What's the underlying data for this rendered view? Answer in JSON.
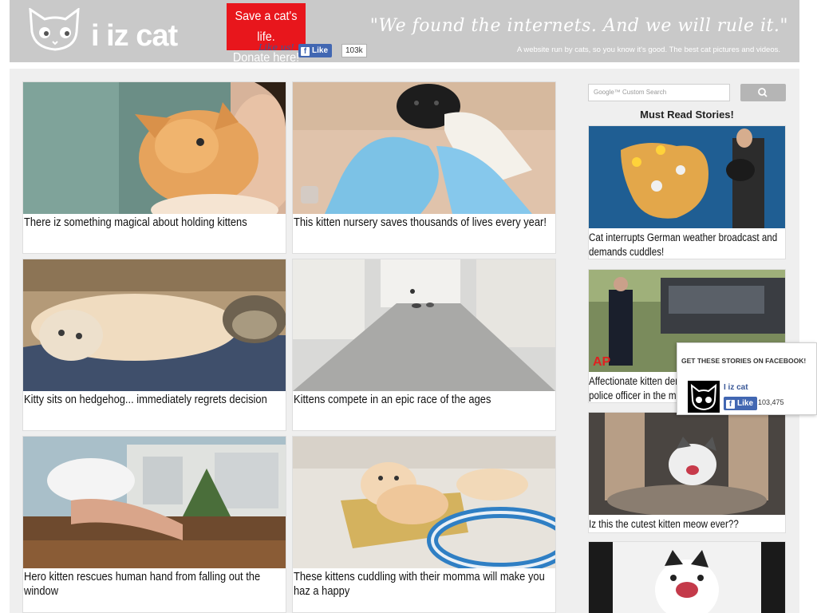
{
  "header": {
    "logo_text": "i iz cat",
    "donate_label": "Save a cat's life.\nDonate here!",
    "donate_line1": "Save a cat's life.",
    "donate_line2": "Donate here!",
    "like_us": "Like us!",
    "fb_like_label": "Like",
    "fb_like_count": "103k",
    "tagline": "\"We found the internets. And we will rule it.\"",
    "subtagline": "A website run by cats, so you know it's good. The best cat pictures and videos."
  },
  "articles": [
    {
      "caption": "There iz something magical about holding kittens"
    },
    {
      "caption": "This kitten nursery saves thousands of lives every year!"
    },
    {
      "caption": "Kitty sits on hedgehog... immediately regrets decision"
    },
    {
      "caption": "Kittens compete in an epic race of the ages"
    },
    {
      "caption": "Hero kitten rescues human hand from falling out the window"
    },
    {
      "caption": "These kittens cuddling with their momma will make you haz a happy"
    }
  ],
  "sidebar": {
    "search_placeholder": "Google™ Custom Search",
    "heading": "Must Read Stories!",
    "stories": [
      {
        "caption": "Cat interrupts German weather broadcast and demands cuddles!"
      },
      {
        "caption": "Affectionate kitten demands cuddles from police officer in the middle of an arrest"
      },
      {
        "caption": "Iz this the cutest kitten meow ever??"
      },
      {
        "caption": ""
      }
    ]
  },
  "fb_popup": {
    "title": "GET THESE STORIES ON FACEBOOK!",
    "page_name": "I iz cat",
    "like_label": "Like",
    "like_count": "103,475"
  },
  "colors": {
    "header_bg": "#c9c9c9",
    "donate_bg": "#e8161c",
    "facebook_blue": "#4267b2",
    "main_bg": "#efefef"
  }
}
